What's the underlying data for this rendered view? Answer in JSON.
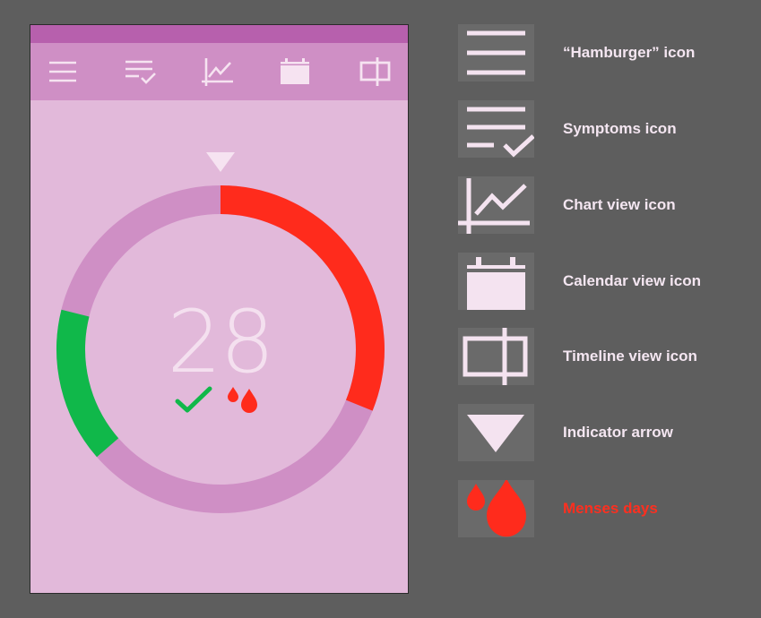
{
  "phone": {
    "day_number": "28",
    "colors": {
      "status_bar": "#b760ad",
      "toolbar": "#cf8fc5",
      "background": "#e2b9da",
      "ring_track": "#cf8fc5",
      "menses": "#ff2b1c",
      "fertile": "#10b84a",
      "icon": "#f6e3f1"
    },
    "toolbar_icons": [
      "hamburger-icon",
      "symptoms-icon",
      "chart-view-icon",
      "calendar-view-icon",
      "timeline-view-icon"
    ]
  },
  "legend": {
    "items": [
      {
        "icon": "hamburger-icon",
        "label": "“Hamburger” icon"
      },
      {
        "icon": "symptoms-icon",
        "label": "Symptoms icon"
      },
      {
        "icon": "chart-view-icon",
        "label": "Chart view icon"
      },
      {
        "icon": "calendar-view-icon",
        "label": "Calendar view icon"
      },
      {
        "icon": "timeline-view-icon",
        "label": "Timeline view icon"
      },
      {
        "icon": "indicator-arrow-icon",
        "label": "Indicator arrow"
      },
      {
        "icon": "menses-drops-icon",
        "label": "Menses days",
        "color": "#ff2f1f"
      }
    ]
  }
}
